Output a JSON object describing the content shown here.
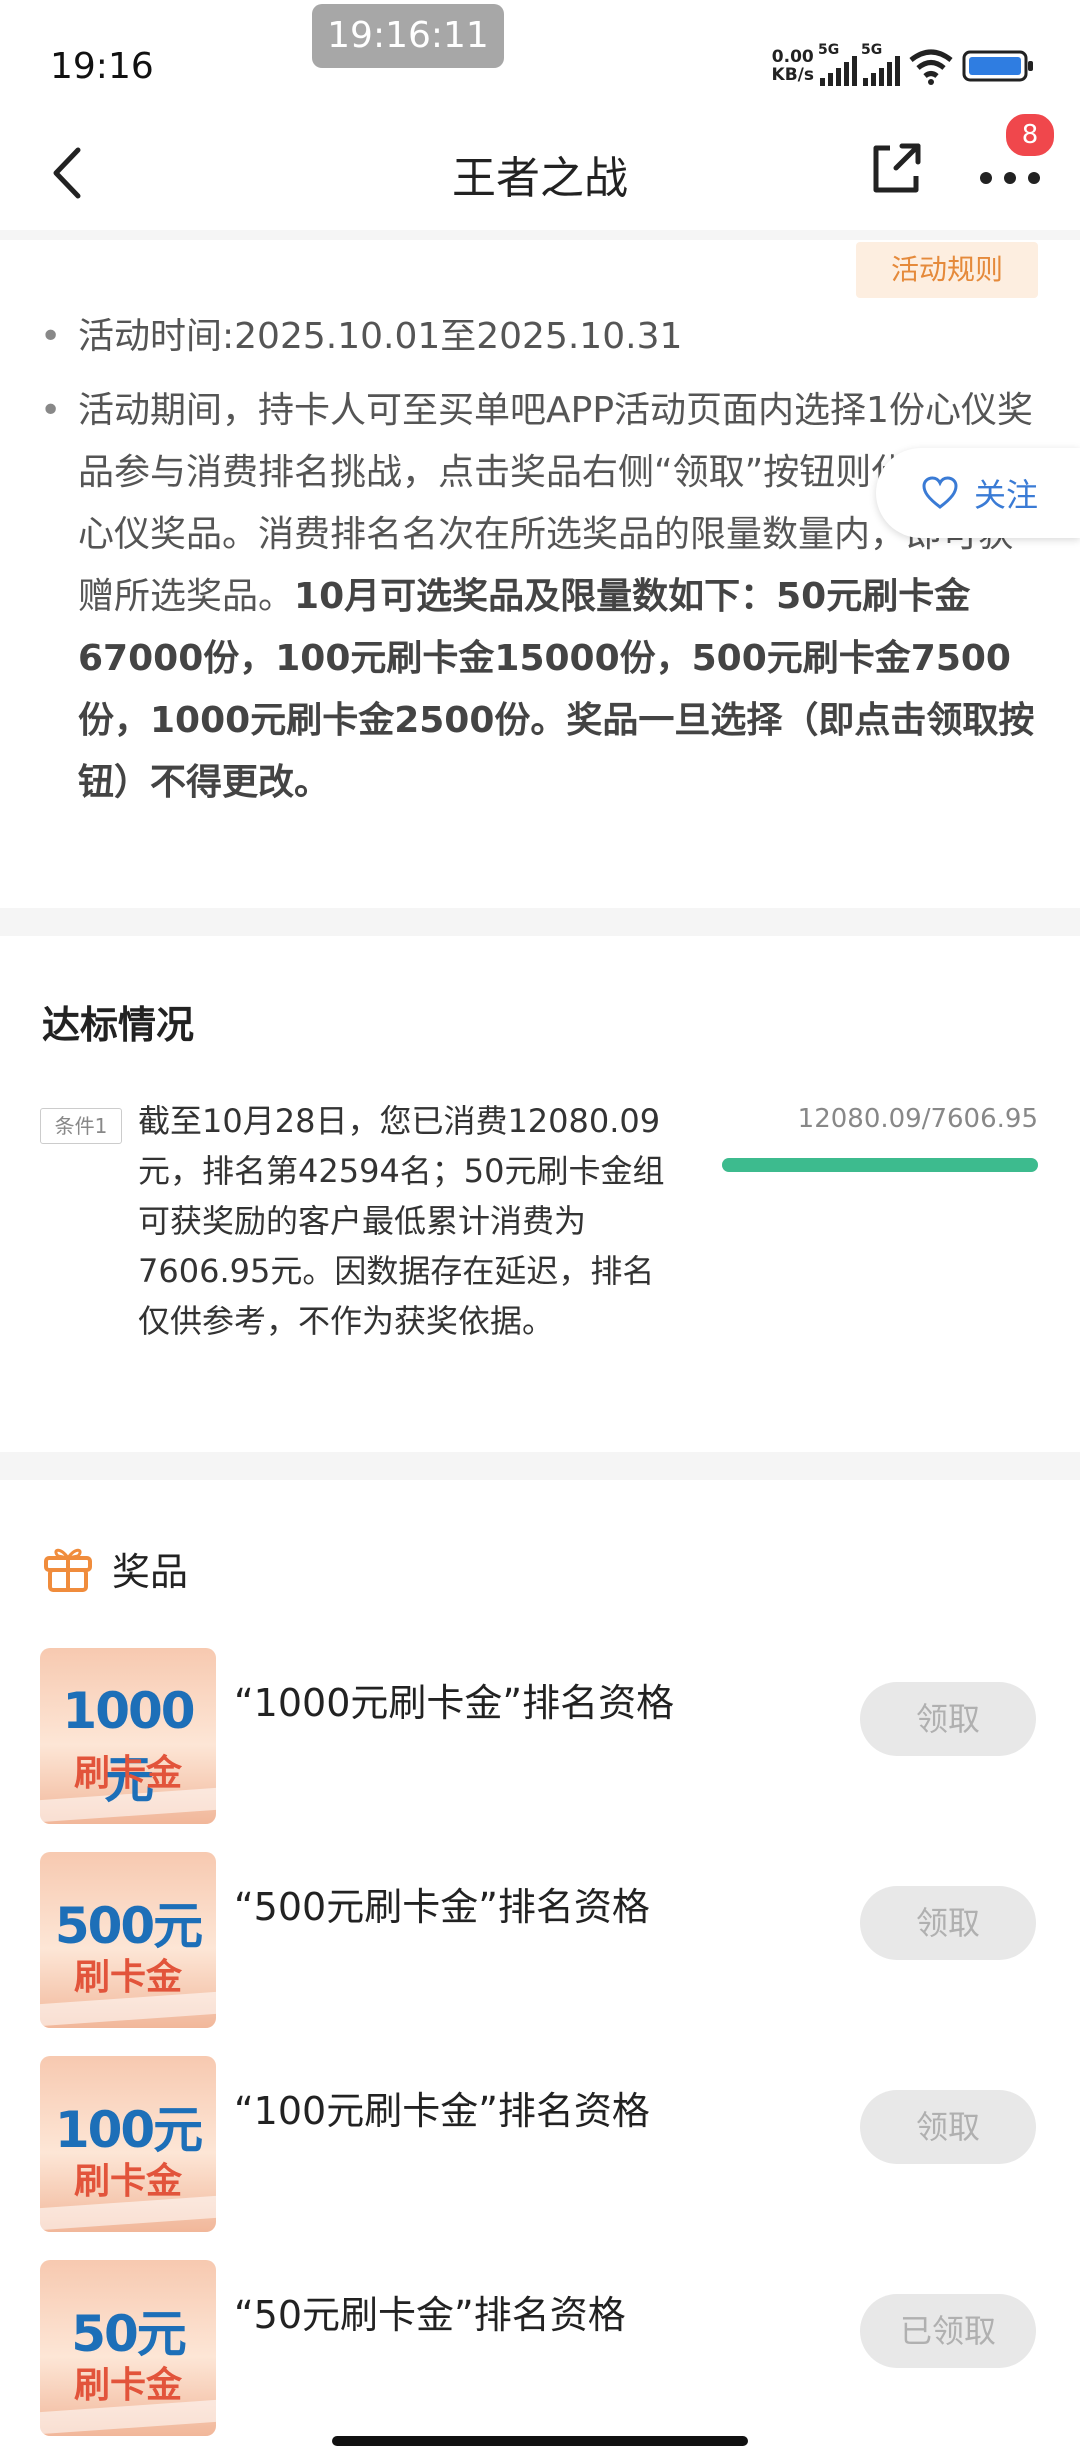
{
  "status_bar": {
    "time": "19:16",
    "clock_overlay": "19:16:11",
    "net_speed_top": "0.00",
    "net_speed_bottom": "KB/s",
    "signal1_label": "5G",
    "signal2_label": "5G"
  },
  "nav": {
    "title": "王者之战",
    "more_badge": "8"
  },
  "rules": {
    "rules_button": "活动规则",
    "item1": "活动时间:2025.10.01至2025.10.31",
    "item2_plain": "活动期间，持卡人可至买单吧APP活动页面内选择1份心仪奖品参与消费排名挑战，点击奖品右侧“领取”按钮则代表选定心仪奖品。消费排名名次在所选奖品的限量数量内，即可获赠所选奖品。",
    "item2_bold": "10月可选奖品及限量数如下：50元刷卡金67000份，100元刷卡金15000份，500元刷卡金7500份，1000元刷卡金2500份。奖品一旦选择（即点击领取按钮）不得更改。",
    "follow_label": "关注"
  },
  "progress": {
    "title": "达标情况",
    "condition_tag": "条件1",
    "condition_text": "截至10月28日，您已消费12080.09元，排名第42594名；50元刷卡金组可获奖励的客户最低累计消费为7606.95元。因数据存在延迟，排名仅供参考，不作为获奖依据。",
    "progress_label": "12080.09/7606.95",
    "progress_fraction": 1.0
  },
  "prizes": {
    "title": "奖品",
    "items": [
      {
        "amount": "1000元",
        "kind": "刷卡金",
        "title": "“1000元刷卡金”排名资格",
        "button": "领取"
      },
      {
        "amount": "500元",
        "kind": "刷卡金",
        "title": "“500元刷卡金”排名资格",
        "button": "领取"
      },
      {
        "amount": "100元",
        "kind": "刷卡金",
        "title": "“100元刷卡金”排名资格",
        "button": "领取"
      },
      {
        "amount": "50元",
        "kind": "刷卡金",
        "title": "“50元刷卡金”排名资格",
        "button": "已领取"
      }
    ]
  },
  "colors": {
    "accent_orange": "#e58a3b",
    "progress_green": "#3dbb8e",
    "link_blue": "#3a7bd5",
    "badge_red": "#f0474c"
  },
  "icons": [
    "back-arrow-icon",
    "share-icon",
    "more-icon",
    "heart-icon",
    "gift-icon"
  ]
}
